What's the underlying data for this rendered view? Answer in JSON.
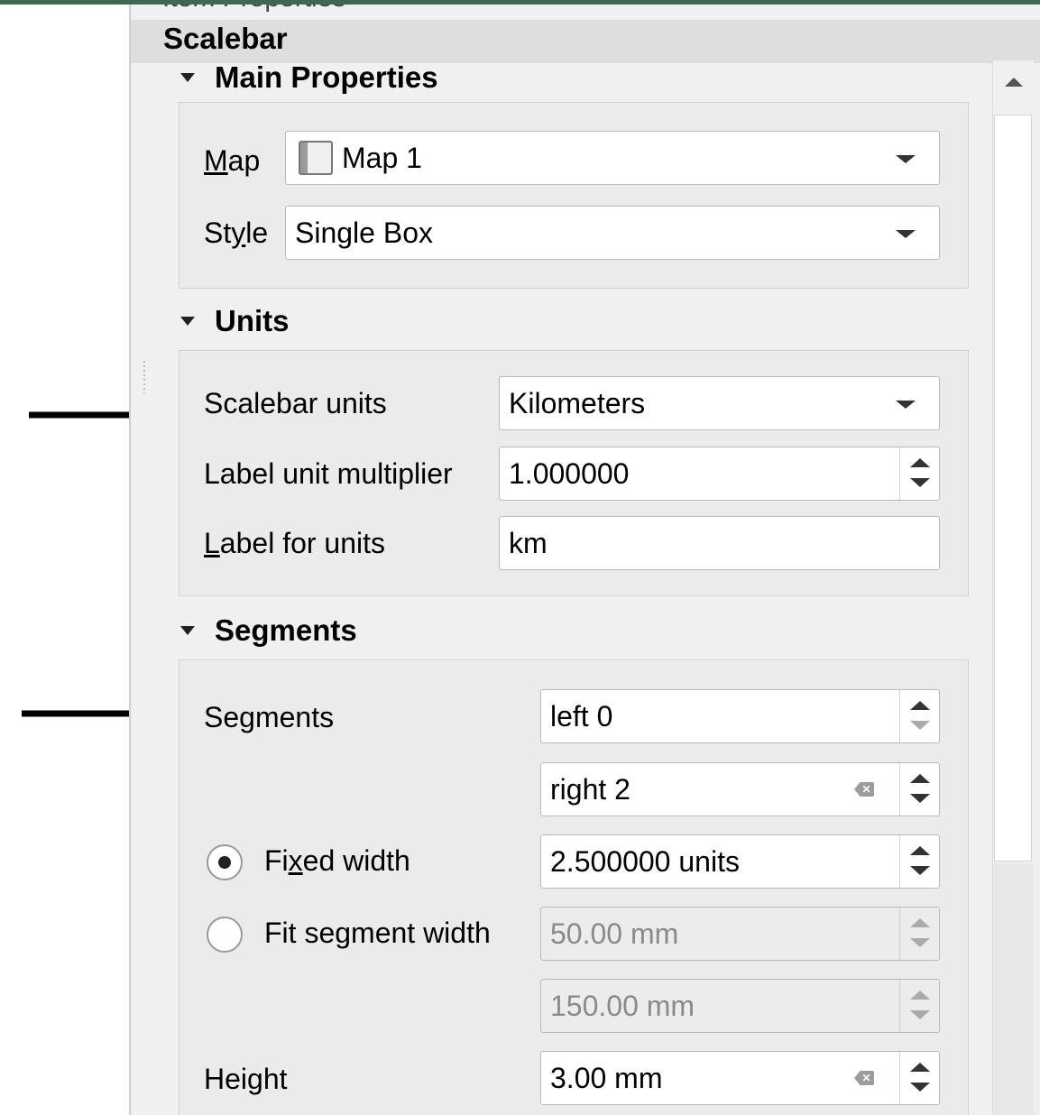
{
  "window": {
    "panel_title": "Item Properties",
    "item_type": "Scalebar"
  },
  "sections": {
    "main": {
      "title": "Main Properties",
      "map_label": "Map",
      "map_value": "Map 1",
      "style_label": "Style",
      "style_value": "Single Box"
    },
    "units": {
      "title": "Units",
      "scalebar_units_label": "Scalebar units",
      "scalebar_units_value": "Kilometers",
      "multiplier_label": "Label unit multiplier",
      "multiplier_value": "1.000000",
      "label_for_units_label": "Label for units",
      "label_for_units_value": "km"
    },
    "segments": {
      "title": "Segments",
      "segments_label": "Segments",
      "left_value": "left 0",
      "right_value": "right 2",
      "fixed_width_label": "Fixed width",
      "fixed_width_value": "2.500000 units",
      "fit_width_label": "Fit segment width",
      "fit_min_value": "50.00 mm",
      "fit_max_value": "150.00 mm",
      "height_label": "Height",
      "height_value": "3.00 mm",
      "width_mode": "fixed"
    }
  },
  "icons": {
    "map": "map-icon",
    "clear": "clear-text-icon",
    "section_toggle": "collapse-triangle-icon",
    "annotation": "arrow-right-icon"
  },
  "colors": {
    "panel_bg": "#f0f0f0",
    "group_bg": "#ebebeb",
    "header_bg": "#dedede",
    "field_bg": "#ffffff",
    "disabled_text": "#8a8a8a"
  }
}
